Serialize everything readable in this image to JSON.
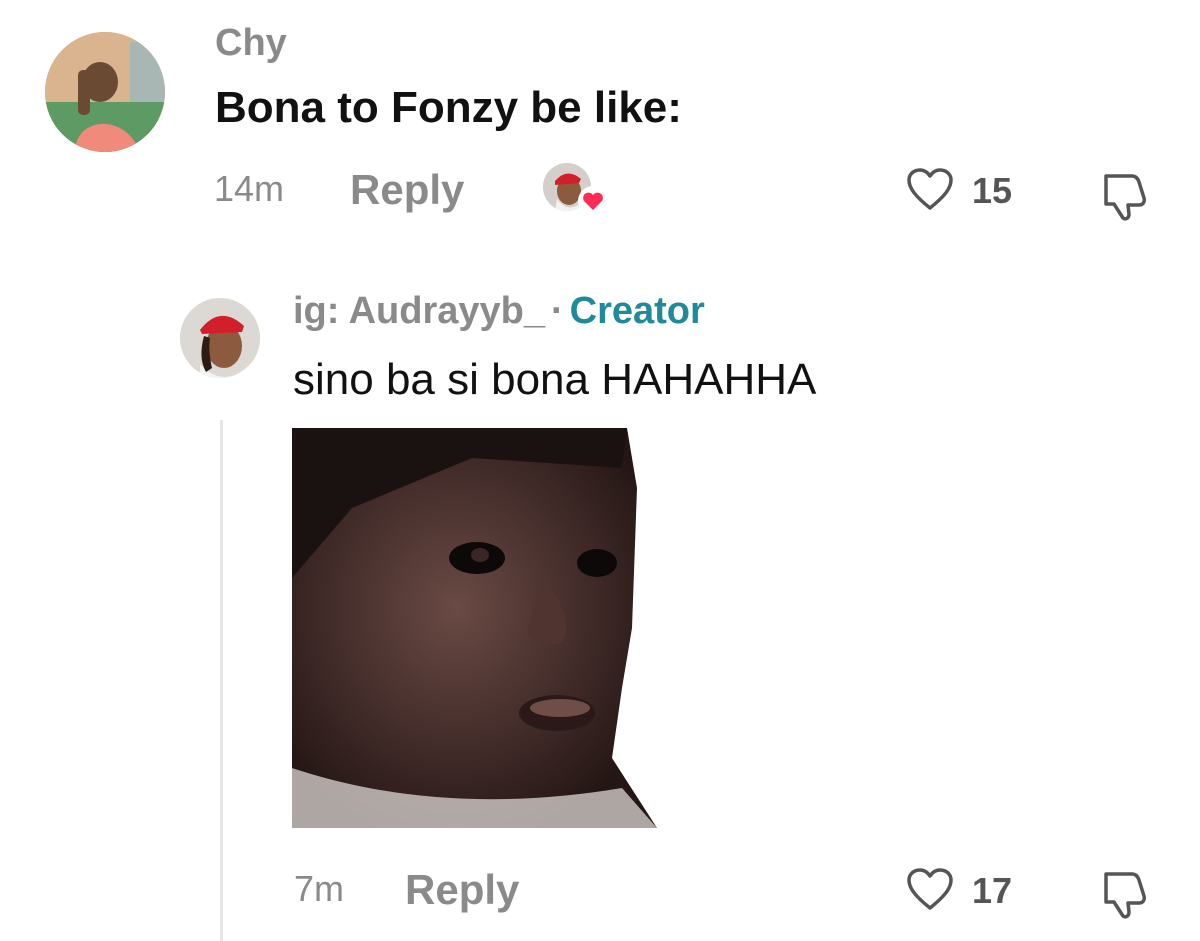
{
  "comment": {
    "username": "Chy",
    "text": "Bona to Fonzy be like:",
    "time": "14m",
    "reply_label": "Reply",
    "likes": "15",
    "liked_by_creator": true
  },
  "reply": {
    "username": "ig: Audrayyb_",
    "separator": "·",
    "badge": "Creator",
    "text": "sino ba si bona HAHAHHA",
    "time": "7m",
    "reply_label": "Reply",
    "likes": "17",
    "has_image": true
  },
  "colors": {
    "creator_accent": "#1f8a9a",
    "meta_gray": "#8a8a8a",
    "heart_red": "#fe2c55"
  },
  "icons": {
    "like": "heart-outline-icon",
    "dislike": "thumbs-down-icon",
    "creator_like": "heart-filled-icon"
  }
}
